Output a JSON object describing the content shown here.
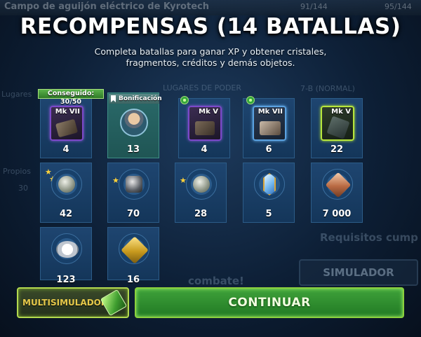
{
  "background": {
    "top_title": "Campo de aguijón eléctrico de Kyrotech",
    "top_counter_1": "91/144",
    "top_counter_2": "95/144",
    "ghost_left_1": "Lugares",
    "ghost_propios": "Propios",
    "ghost_30": "30",
    "ghost_lugares_poder": "LUGARES DE PODER",
    "ghost_nivel": "7-B (NORMAL)",
    "ghost_requisitos": "Requisitos cump",
    "ghost_simulador": "SIMULADOR",
    "ghost_combate": "combate!"
  },
  "header": {
    "title": "RECOMPENSAS (14 BATALLAS)",
    "subtitle": "Completa batallas para ganar XP y obtener cristales, fragmentos, créditos y demás objetos."
  },
  "rewards": {
    "row1": [
      {
        "mk": "Mk VII",
        "count": "4",
        "banner": "Conseguido: 30/50"
      },
      {
        "badge": "Bonificación",
        "count": "13"
      },
      {
        "mk": "Mk V",
        "count": "4"
      },
      {
        "mk": "Mk VII",
        "count": "6"
      },
      {
        "mk": "Mk V",
        "count": "22"
      }
    ],
    "row2": [
      {
        "count": "42"
      },
      {
        "count": "70"
      },
      {
        "count": "28"
      },
      {
        "count": "5"
      },
      {
        "count": "7 000"
      }
    ],
    "row3": [
      {
        "count": "123"
      },
      {
        "count": "16"
      }
    ]
  },
  "buttons": {
    "multisim": "MULTISIMULADOR",
    "continue": "CONTINUAR"
  },
  "colors": {
    "accent_green": "#3fa23a",
    "purple_gear": "#7c48c9",
    "blue_gear": "#5aa1e0",
    "green_gear": "#b6e63b"
  }
}
